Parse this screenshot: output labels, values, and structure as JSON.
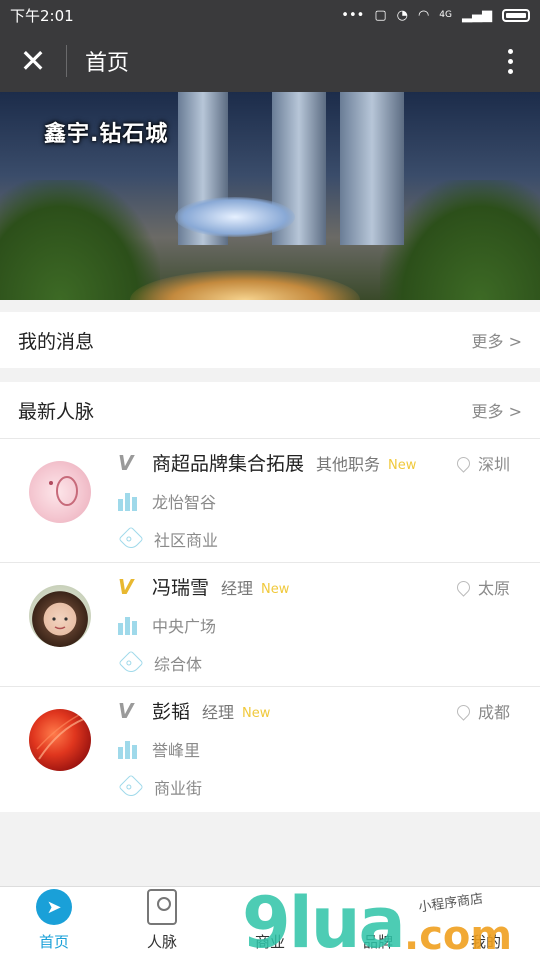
{
  "status_bar": {
    "time": "下午2:01",
    "network": "4G",
    "icons": [
      "dots-icon",
      "sim-icon",
      "alarm-icon",
      "wifi-icon",
      "signal-icon",
      "battery-icon"
    ]
  },
  "header": {
    "title": "首页",
    "close_icon": "close-icon",
    "more_icon": "more-vertical-icon"
  },
  "banner": {
    "title": "鑫宇.钻石城"
  },
  "messages": {
    "label": "我的消息",
    "more": "更多 >"
  },
  "contacts_section": {
    "label": "最新人脉",
    "more": "更多 >"
  },
  "contacts": [
    {
      "name": "商超品牌集合拓展",
      "position": "其他职务",
      "badge": "New",
      "city": "深圳",
      "company": "龙怡智谷",
      "category": "社区商业",
      "verified": "gray"
    },
    {
      "name": "冯瑞雪",
      "position": "经理",
      "badge": "New",
      "city": "太原",
      "company": "中央广场",
      "category": "综合体",
      "verified": "gold"
    },
    {
      "name": "彭韬",
      "position": "经理",
      "badge": "New",
      "city": "成都",
      "company": "誉峰里",
      "category": "商业街",
      "verified": "gray"
    }
  ],
  "bottom_nav": [
    {
      "label": "首页",
      "icon": "compass-icon",
      "active": true
    },
    {
      "label": "人脉",
      "icon": "contact-card-icon",
      "active": false
    },
    {
      "label": "商业",
      "icon": "building-icon",
      "active": false
    },
    {
      "label": "品牌",
      "icon": "brand-icon",
      "active": false
    },
    {
      "label": "我的",
      "icon": "profile-icon",
      "active": false
    }
  ],
  "watermark": {
    "main": "9lua",
    "sub": ".com",
    "script": "小程序商店"
  },
  "colors": {
    "topbar": "#3a3a3c",
    "accent": "#1aa0d8",
    "new_badge": "#f0c93c",
    "icon_cyan": "#9fd9ea"
  }
}
